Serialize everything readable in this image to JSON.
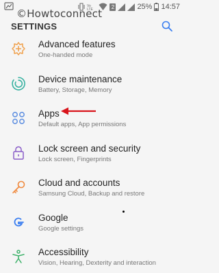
{
  "watermark": "©Howtoconnect",
  "status_bar": {
    "battery": "25%",
    "time": "14:57",
    "sim_badge": "2"
  },
  "header": {
    "title": "SETTINGS"
  },
  "items": [
    {
      "label": "Advanced features",
      "sub": "One-handed mode",
      "icon": "advanced-features-icon",
      "color": "#f0a04b"
    },
    {
      "label": "Device maintenance",
      "sub": "Battery, Storage, Memory",
      "icon": "device-maintenance-icon",
      "color": "#36b1a0"
    },
    {
      "label": "Apps",
      "sub": "Default apps, App permissions",
      "icon": "apps-icon",
      "color": "#5b8de0"
    },
    {
      "label": "Lock screen and security",
      "sub": "Lock screen, Fingerprints",
      "icon": "lock-icon",
      "color": "#8a5cc8"
    },
    {
      "label": "Cloud and accounts",
      "sub": "Samsung Cloud, Backup and restore",
      "icon": "key-icon",
      "color": "#f08a3e"
    },
    {
      "label": "Google",
      "sub": "Google settings",
      "icon": "google-icon",
      "color": "#3a7ef0"
    },
    {
      "label": "Accessibility",
      "sub": "Vision, Hearing, Dexterity and interaction",
      "icon": "accessibility-icon",
      "color": "#3fb26b"
    }
  ],
  "colors": {
    "accent": "#3a7ef0",
    "annotation_arrow": "#d8141b"
  }
}
